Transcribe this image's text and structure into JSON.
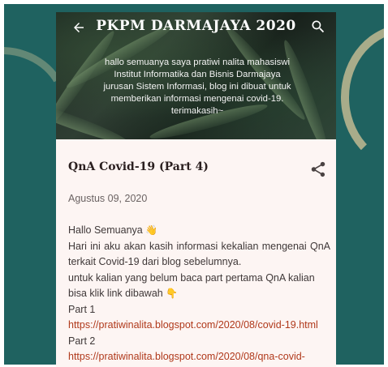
{
  "blog": {
    "title": "PKPM DARMAJAYA 2020",
    "description": "hallo semuanya saya pratiwi nalita mahasiswi Institut Informatika dan Bisnis Darmajaya jurusan Sistem Informasi, blog ini dibuat untuk memberikan informasi mengenai covid-19. terimakasih~"
  },
  "icons": {
    "back": "arrow-left-icon",
    "search": "search-icon",
    "share": "share-icon"
  },
  "post": {
    "title": "QnA Covid-19 (Part 4)",
    "date": "Agustus 09, 2020",
    "greeting": "Hallo Semuanya",
    "greeting_emoji": "👋",
    "intro": "Hari ini aku akan kasih informasi kekalian mengenai QnA terkait Covid-19 dari blog sebelumnya.",
    "instruction": "untuk kalian yang belum baca part pertama QnA kalian bisa klik link dibawah",
    "instruction_emoji": "👇",
    "part1_label": "Part 1",
    "part1_link": "https://pratiwinalita.blogspot.com/2020/08/covid-19.html",
    "part2_label": "Part 2",
    "part2_link": "https://pratiwinalita.blogspot.com/2020/08/qna-covid-"
  },
  "colors": {
    "background": "#1f6260",
    "page": "#fdf5f3",
    "link": "#b0391b",
    "title": "#2a1f1f"
  }
}
